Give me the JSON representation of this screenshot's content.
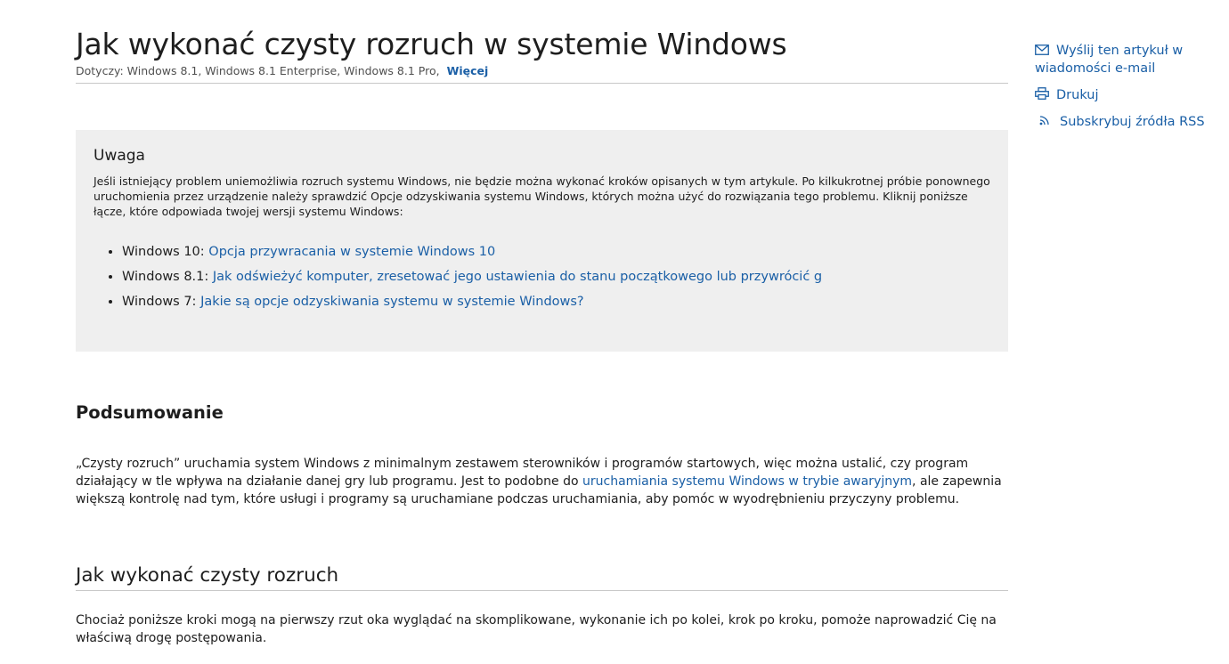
{
  "article": {
    "title": "Jak wykonać czysty rozruch w systemie Windows",
    "applies_to": "Dotyczy: Windows 8.1, Windows 8.1 Enterprise, Windows 8.1 Pro,",
    "more_link": "Więcej"
  },
  "note": {
    "heading": "Uwaga",
    "text": "Jeśli istniejący problem uniemożliwia rozruch systemu Windows, nie będzie można wykonać kroków opisanych w tym artykule. Po kilkukrotnej próbie ponownego uruchomienia przez urządzenie należy sprawdzić Opcje odzyskiwania systemu Windows, których można użyć do rozwiązania tego problemu. Kliknij poniższe łącze, które odpowiada twojej wersji systemu Windows:",
    "items": [
      {
        "prefix": "Windows 10: ",
        "link": "Opcja przywracania w systemie Windows 10"
      },
      {
        "prefix": "Windows 8.1: ",
        "link": "Jak odświeżyć komputer, zresetować jego ustawienia do stanu początkowego lub przywrócić g"
      },
      {
        "prefix": "Windows 7: ",
        "link": "Jakie są opcje odzyskiwania systemu w systemie Windows?"
      }
    ]
  },
  "summary": {
    "heading": "Podsumowanie",
    "text_before": "„Czysty rozruch” uruchamia system Windows z minimalnym zestawem sterowników i programów startowych, więc można ustalić, czy program działający w tle wpływa na działanie danej gry lub programu.  Jest to podobne do ",
    "link": "uruchamiania systemu Windows w trybie awaryjnym",
    "text_after": ", ale zapewnia większą kontrolę nad tym, które usługi i programy są uruchamiane podczas uruchamiania, aby pomóc w wyodrębnieniu przyczyny problemu."
  },
  "clean_boot": {
    "heading": "Jak wykonać czysty rozruch",
    "text": "Chociaż poniższe kroki mogą na pierwszy rzut oka wyglądać na skomplikowane, wykonanie ich po kolei, krok po kroku, pomoże naprowadzić Cię na właściwą drogę postępowania."
  },
  "sidebar": {
    "email": "Wyślij ten artykuł w wiadomości e-mail",
    "print": "Drukuj",
    "rss": "Subskrybuj źródła RSS"
  },
  "icons": {
    "email": "envelope-icon",
    "print": "printer-icon",
    "rss": "rss-icon"
  },
  "colors": {
    "link": "#1a5fa6",
    "note_background": "#efefef",
    "text": "#1e1e1e",
    "divider": "#c8c8c8"
  }
}
